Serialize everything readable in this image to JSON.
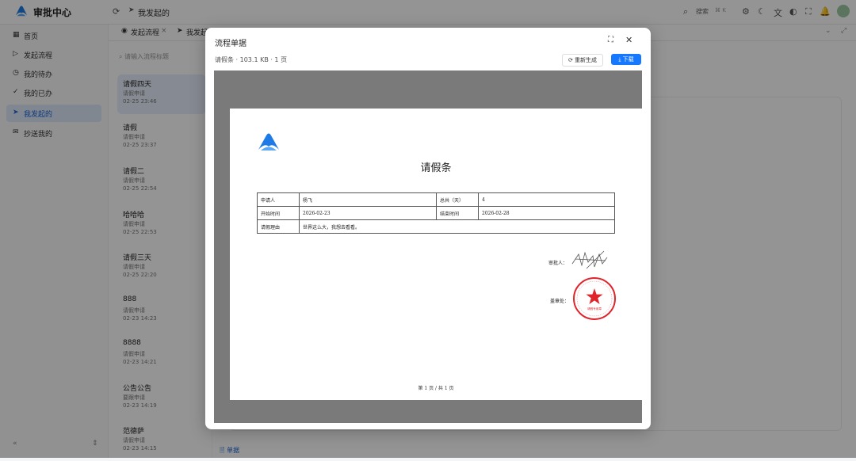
{
  "app": {
    "title": "审批中心"
  },
  "topbar": {
    "breadcrumb": "我发起的",
    "search_label": "搜索",
    "search_shortcut": "⌘ K"
  },
  "sidebar": {
    "items": [
      {
        "label": "首页",
        "icon": "grid-icon"
      },
      {
        "label": "发起流程",
        "icon": "play-icon"
      },
      {
        "label": "我的待办",
        "icon": "clock-icon"
      },
      {
        "label": "我的已办",
        "icon": "check-circle-icon"
      },
      {
        "label": "我发起的",
        "icon": "send-icon",
        "active": true
      },
      {
        "label": "抄送我的",
        "icon": "mail-icon"
      }
    ]
  },
  "tabs": [
    {
      "label": "发起流程"
    },
    {
      "label": "我发起"
    }
  ],
  "list": {
    "search_placeholder": "请输入流程标题",
    "items": [
      {
        "title": "请假四天",
        "subtitle": "请假申请",
        "date": "02-25 23:46",
        "selected": true
      },
      {
        "title": "请假",
        "subtitle": "请假申请",
        "date": "02-25 23:37"
      },
      {
        "title": "请假二",
        "subtitle": "请假申请",
        "date": "02-25 22:54"
      },
      {
        "title": "哈哈哈",
        "subtitle": "请假申请",
        "date": "02-25 22:53"
      },
      {
        "title": "请假三天",
        "subtitle": "请假申请",
        "date": "02-25 22:20"
      },
      {
        "title": "888",
        "subtitle": "请假申请",
        "date": "02-23 14:23"
      },
      {
        "title": "8888",
        "subtitle": "请假申请",
        "date": "02-23 14:21"
      },
      {
        "title": "公告公告",
        "subtitle": "要跟申请",
        "date": "02-23 14:19"
      },
      {
        "title": "范德萨",
        "subtitle": "请假申请",
        "date": "02-23 14:15"
      }
    ],
    "footer_link": "单据"
  },
  "modal": {
    "title": "流程单据",
    "meta": "请假条 · 103.1 KB · 1 页",
    "regen_label": "重新生成",
    "download_label": "下载",
    "document": {
      "title": "请假条",
      "rows": [
        [
          "申请人",
          "杨飞",
          "总共（天）",
          "4"
        ],
        [
          "开始时间",
          "2026-02-23",
          "结束时间",
          "2026-02-28"
        ]
      ],
      "reason_label": "请假理由",
      "reason_value": "世界这么大，我想去看看。",
      "approver_label": "审批人：",
      "seal_label": "盖章处：",
      "seal_text": "请假专用章",
      "pager": "第 1 页 / 共 1 页"
    }
  },
  "colors": {
    "accent": "#1677ff",
    "seal": "#e0242b",
    "active_nav_bg": "#dde8f8"
  }
}
